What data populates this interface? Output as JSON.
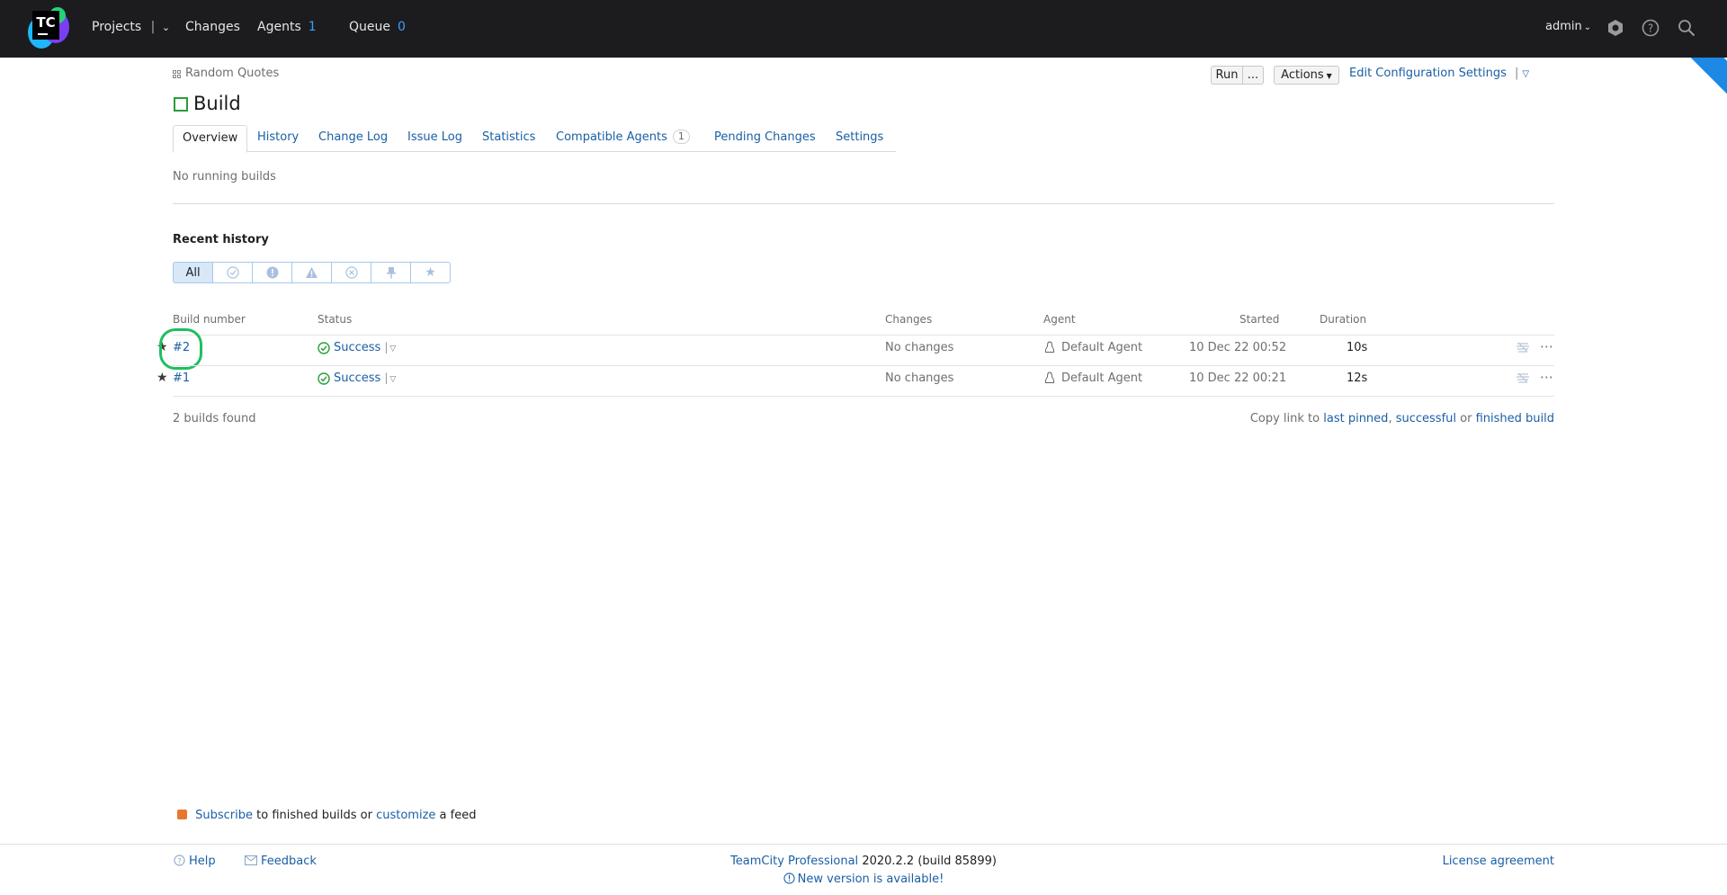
{
  "topbar": {
    "logo_text": "TC",
    "projects": "Projects",
    "changes": "Changes",
    "agents": "Agents",
    "agents_count": "1",
    "queue": "Queue",
    "queue_count": "0",
    "user": "admin"
  },
  "breadcrumb": "Random Quotes",
  "title": "Build",
  "actions": {
    "run": "Run",
    "run_more": "...",
    "actions": "Actions",
    "edit": "Edit Configuration Settings",
    "edit_sep": "|"
  },
  "tabs": [
    {
      "label": "Overview"
    },
    {
      "label": "History"
    },
    {
      "label": "Change Log"
    },
    {
      "label": "Issue Log"
    },
    {
      "label": "Statistics"
    },
    {
      "label": "Compatible Agents",
      "badge": "1"
    },
    {
      "label": "Pending Changes"
    },
    {
      "label": "Settings"
    }
  ],
  "no_running": "No running builds",
  "recent_history": "Recent history",
  "filters": {
    "all": "All"
  },
  "table": {
    "headers": {
      "build_number": "Build number",
      "status": "Status",
      "changes": "Changes",
      "agent": "Agent",
      "started": "Started",
      "duration": "Duration"
    },
    "rows": [
      {
        "number": "#2",
        "status": "Success",
        "changes": "No changes",
        "agent": "Default Agent",
        "started": "10 Dec 22 00:52",
        "duration": "10s"
      },
      {
        "number": "#1",
        "status": "Success",
        "changes": "No changes",
        "agent": "Default Agent",
        "started": "10 Dec 22 00:21",
        "duration": "12s"
      }
    ]
  },
  "builds_found": "2 builds found",
  "copy_link": {
    "prefix": "Copy link to",
    "last_pinned": "last pinned",
    "comma": ",",
    "successful": "successful",
    "or": "or",
    "finished": "finished build"
  },
  "subscribe": {
    "subscribe": "Subscribe",
    "middle": "to finished builds or",
    "customize": "customize",
    "suffix": "a feed"
  },
  "footer": {
    "help": "Help",
    "feedback": "Feedback",
    "product": "TeamCity Professional",
    "version": "2020.2.2 (build 85899)",
    "new_version": "New version is available!",
    "license": "License agreement"
  },
  "colors": {
    "accent": "#1a5fa5",
    "success": "#2a9d3a",
    "topbar": "#1c1c1e",
    "highlight": "#1fbf60"
  }
}
